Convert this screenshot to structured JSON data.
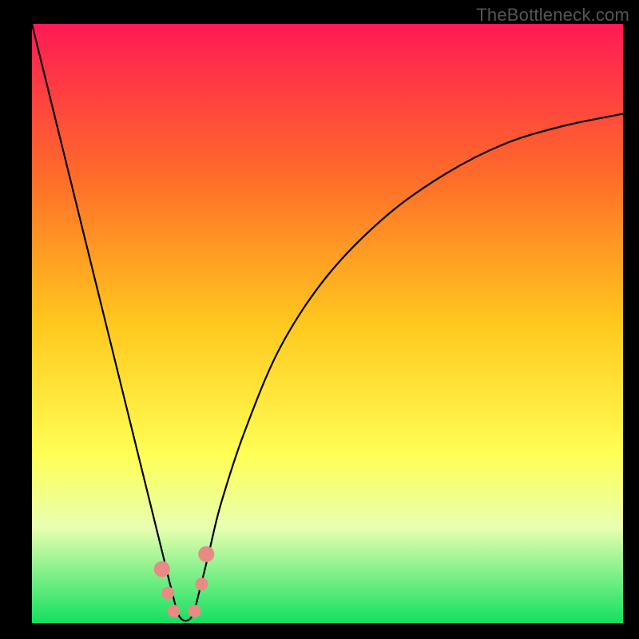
{
  "watermark": "TheBottleneck.com",
  "chart_data": {
    "type": "line",
    "title": "",
    "xlabel": "",
    "ylabel": "",
    "xlim": [
      0,
      100
    ],
    "ylim": [
      0,
      100
    ],
    "gradient_stops": [
      {
        "offset": 0,
        "color": "#ff1a55"
      },
      {
        "offset": 25,
        "color": "#ff6a2a"
      },
      {
        "offset": 50,
        "color": "#ffc81e"
      },
      {
        "offset": 72,
        "color": "#ffff55"
      },
      {
        "offset": 84,
        "color": "#e8ffb0"
      },
      {
        "offset": 100,
        "color": "#13e060"
      }
    ],
    "series": [
      {
        "name": "bottleneck-curve",
        "x": [
          0,
          5,
          10,
          15,
          18,
          20,
          22,
          23.5,
          25,
          27,
          28.5,
          30,
          32,
          36,
          42,
          50,
          60,
          70,
          80,
          90,
          100
        ],
        "y": [
          100,
          80,
          60,
          40,
          28,
          20,
          12,
          6,
          1,
          1,
          6,
          12,
          20,
          32,
          46,
          58,
          68,
          75,
          80,
          83,
          85
        ]
      }
    ],
    "markers": {
      "name": "highlight-points",
      "color": "#e98b84",
      "radius_major": 10,
      "radius_minor": 8,
      "points": [
        {
          "x": 22.0,
          "y": 9.0,
          "r": "major"
        },
        {
          "x": 23.0,
          "y": 5.0,
          "r": "minor"
        },
        {
          "x": 24.0,
          "y": 2.0,
          "r": "minor"
        },
        {
          "x": 27.5,
          "y": 2.0,
          "r": "minor"
        },
        {
          "x": 28.7,
          "y": 6.5,
          "r": "minor"
        },
        {
          "x": 29.5,
          "y": 11.5,
          "r": "major"
        }
      ]
    }
  }
}
